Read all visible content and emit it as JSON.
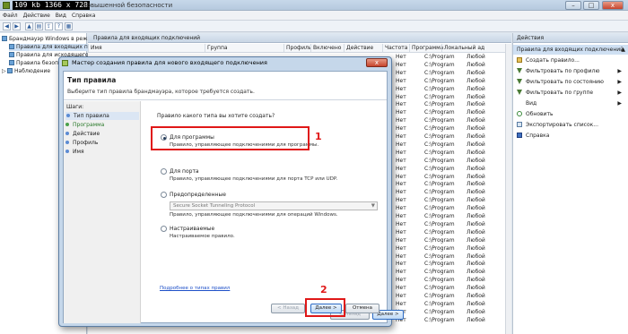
{
  "window": {
    "resolution_badge": "109 kb 1366 x 728",
    "title": "повышенной безопасности",
    "buttons": {
      "minimize": "–",
      "maximize": "□",
      "close": "x"
    }
  },
  "menu": [
    "Файл",
    "Действие",
    "Вид",
    "Справка"
  ],
  "tree": {
    "items": [
      "Брандмауэр Windows в режим",
      "Правила для входящих по",
      "Правила для исходящего по",
      "Правила безопасности п",
      "Наблюдение"
    ]
  },
  "center": {
    "header": "Правила для входящих подключений",
    "columns": [
      "Имя",
      "Группа",
      "Профиль",
      "Включено",
      "Действие",
      "Частота",
      "Программа",
      "Локальный ад"
    ],
    "rows_visible": [
      {
        "action": "Нет",
        "program": "C:\\Program",
        "local": "Любой"
      },
      {
        "action": "Нет",
        "program": "C:\\Program",
        "local": "Любой"
      },
      {
        "action": "Нет",
        "program": "C:\\Program",
        "local": "Любой"
      },
      {
        "action": "Нет",
        "program": "C:\\Program",
        "local": "Любой"
      },
      {
        "action": "Нет",
        "program": "C:\\Program",
        "local": "Любой"
      },
      {
        "action": "Нет",
        "program": "C:\\Program",
        "local": "Любой"
      },
      {
        "action": "Нет",
        "program": "C:\\Program",
        "local": "Любой"
      },
      {
        "action": "Нет",
        "program": "C:\\Program",
        "local": "Любой"
      },
      {
        "action": "Нет",
        "program": "C:\\Program",
        "local": "Любой"
      },
      {
        "action": "Нет",
        "program": "C:\\Program",
        "local": "Любой"
      },
      {
        "action": "Нет",
        "program": "C:\\Program",
        "local": "Любой"
      },
      {
        "action": "Нет",
        "program": "C:\\Program",
        "local": "Любой"
      },
      {
        "action": "Нет",
        "program": "C:\\Program",
        "local": "Любой"
      },
      {
        "action": "Нет",
        "program": "C:\\Program",
        "local": "Любой"
      },
      {
        "action": "Нет",
        "program": "C:\\Program",
        "local": "Любой"
      },
      {
        "action": "Нет",
        "program": "C:\\Program",
        "local": "Любой"
      },
      {
        "action": "Нет",
        "program": "C:\\Program",
        "local": "Любой"
      },
      {
        "action": "Нет",
        "program": "C:\\Program",
        "local": "Любой"
      },
      {
        "action": "Нет",
        "program": "C:\\Program",
        "local": "Любой"
      },
      {
        "action": "Нет",
        "program": "C:\\Program",
        "local": "Любой"
      },
      {
        "action": "Нет",
        "program": "C:\\Program",
        "local": "Любой"
      },
      {
        "action": "Нет",
        "program": "C:\\Program",
        "local": "Любой"
      },
      {
        "action": "Нет",
        "program": "C:\\Program",
        "local": "Любой"
      },
      {
        "action": "Нет",
        "program": "C:\\Program",
        "local": "Любой"
      },
      {
        "action": "Нет",
        "program": "C:\\Program",
        "local": "Любой"
      },
      {
        "action": "Нет",
        "program": "C:\\Program",
        "local": "Любой"
      },
      {
        "action": "Нет",
        "program": "C:\\Program",
        "local": "Любой"
      },
      {
        "action": "Нет",
        "program": "C:\\Program",
        "local": "Любой"
      },
      {
        "action": "Нет",
        "program": "C:\\Program",
        "local": "Любой"
      },
      {
        "action": "Нет",
        "program": "C:\\Program",
        "local": "Любой"
      },
      {
        "action": "Нет",
        "program": "C:\\Program",
        "local": "Любой"
      },
      {
        "action": "Нет",
        "program": "C:\\Program",
        "local": "Любой"
      },
      {
        "action": "Нет",
        "program": "C:\\Program",
        "local": "Любой"
      },
      {
        "action": "Нет",
        "program": "C:\\Program",
        "local": "Любой"
      }
    ]
  },
  "actions": {
    "header": "Действия",
    "subheader": "Правила для входящих подключений",
    "items": [
      {
        "label": "Создать правило...",
        "icon": "new-rule-icon",
        "submenu": false
      },
      {
        "label": "Фильтровать по профилю",
        "icon": "filter-icon",
        "submenu": true
      },
      {
        "label": "Фильтровать по состоянию",
        "icon": "filter-icon",
        "submenu": true
      },
      {
        "label": "Фильтровать по группе",
        "icon": "filter-icon",
        "submenu": true
      },
      {
        "label": "Вид",
        "icon": "",
        "submenu": true
      },
      {
        "label": "Обновить",
        "icon": "refresh-icon",
        "submenu": false
      },
      {
        "label": "Экспортировать список...",
        "icon": "export-icon",
        "submenu": false
      },
      {
        "label": "Справка",
        "icon": "help-icon",
        "submenu": false
      }
    ]
  },
  "dialog": {
    "title": "Мастер создания правила для нового входящего подключения",
    "heading": "Тип правила",
    "subheading": "Выберите тип правила брандмауэра, которое требуется создать.",
    "steps_title": "Шаги:",
    "steps": [
      "Тип правила",
      "Программа",
      "Действие",
      "Профиль",
      "Имя"
    ],
    "question": "Правило какого типа вы хотите создать?",
    "options": [
      {
        "label": "Для программы",
        "desc": "Правило, управляющее подключениями для программы.",
        "selected": true
      },
      {
        "label": "Для порта",
        "desc": "Правило, управляющее подключениями для порта TCP или UDP.",
        "selected": false
      },
      {
        "label": "Предопределенные",
        "desc": "Правило, управляющее подключениями для операций Windows.",
        "selected": false
      },
      {
        "label": "Настраиваемые",
        "desc": "Настраиваемое правило.",
        "selected": false
      }
    ],
    "predefined_value": "Secure Socket Tunneling Protocol",
    "link": "Подробнее о типах правил",
    "buttons": {
      "back": "< Назад",
      "next": "Далее >",
      "cancel": "Отмена"
    }
  },
  "annotations": {
    "first": "1",
    "second": "2"
  },
  "colors": {
    "accent": "#e01818",
    "selection": "#cfe0f3"
  }
}
